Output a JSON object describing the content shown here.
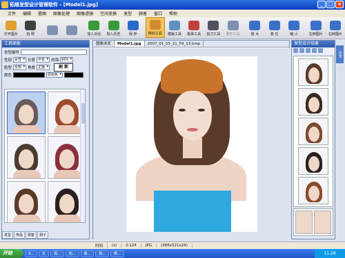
{
  "window": {
    "title": "拓维发型设计管理软件 - [Model1.jpg]",
    "buttons": [
      "_",
      "□",
      "×"
    ]
  },
  "menu": [
    "文件",
    "编辑",
    "提图",
    "图像处理",
    "图像滤镜",
    "空间变换",
    "发型",
    "顾客",
    "窗口",
    "帮助"
  ],
  "toolbar": [
    {
      "label": "打开图片",
      "icon": "open-image-icon",
      "color": "#e0a030"
    },
    {
      "label": "拍 照",
      "icon": "camera-icon",
      "color": "#404040"
    },
    {
      "label": "",
      "icon": "undo-icon",
      "color": "#8090b0",
      "disabled": true
    },
    {
      "label": "",
      "icon": "redo-icon",
      "color": "#8090b0",
      "disabled": true
    },
    {
      "label": "加入对比",
      "icon": "add-compare-icon",
      "color": "#3a9a3a"
    },
    {
      "label": "加入历史",
      "icon": "add-history-icon",
      "color": "#3a9a3a"
    },
    {
      "label": "保 存",
      "icon": "save-icon",
      "color": "#2a6ac8"
    },
    {
      "label": "移动工具",
      "icon": "move-tool-icon",
      "color": "#d08a30",
      "active": true
    },
    {
      "label": "模板工具",
      "icon": "template-tool-icon",
      "color": "#6090c0"
    },
    {
      "label": "挑染工具",
      "icon": "highlight-tool-icon",
      "color": "#c04040"
    },
    {
      "label": "剪刀工具",
      "icon": "scissors-icon",
      "color": "#505060"
    },
    {
      "label": "变形工具",
      "icon": "transform-tool-icon",
      "color": "#8090b0",
      "disabled": true
    },
    {
      "label": "放 大",
      "icon": "zoom-in-icon",
      "color": "#3a70c8"
    },
    {
      "label": "复 位",
      "icon": "reset-zoom-icon",
      "color": "#3a70c8"
    },
    {
      "label": "缩 小",
      "icon": "zoom-out-icon",
      "color": "#3a70c8"
    },
    {
      "label": "左转图片",
      "icon": "rotate-left-icon",
      "color": "#3a70c8"
    },
    {
      "label": "右转图片",
      "icon": "rotate-right-icon",
      "color": "#3a70c8"
    }
  ],
  "left_panel": {
    "title": "工具面板",
    "id_label": "发型编号",
    "row1": {
      "gender_label": "性别",
      "gender": "女性",
      "length_label": "长度",
      "length": "中长",
      "bangs_label": "刘海",
      "bangs": "斜刘"
    },
    "row2": {
      "face_label": "脸型",
      "face": "全部",
      "angle_label": "角度",
      "angle": "正面"
    },
    "refresh_label": "刷 新",
    "color_label": "颜色",
    "color_value": "原始色",
    "bottom_tabs": [
      "发型",
      "饰品",
      "顾客",
      "胡子"
    ]
  },
  "center": {
    "tabs": [
      "图像浏览",
      "Model1.jpg",
      "2007_01_05_21_59_13.bmp"
    ],
    "active_tab": 1
  },
  "right_panel": {
    "title": "发型设计结果",
    "side_tab": "历史"
  },
  "status": {
    "time_label": "时间",
    "time_unit": "(s)",
    "time_value": "0.124",
    "format": "JPG",
    "size": "(386x521x24)"
  },
  "taskbar": {
    "start": "开始",
    "tasks": [
      "4...",
      "无",
      "视...",
      "拓...",
      "我...",
      "我...",
      "新..."
    ],
    "clock": "11:28"
  }
}
